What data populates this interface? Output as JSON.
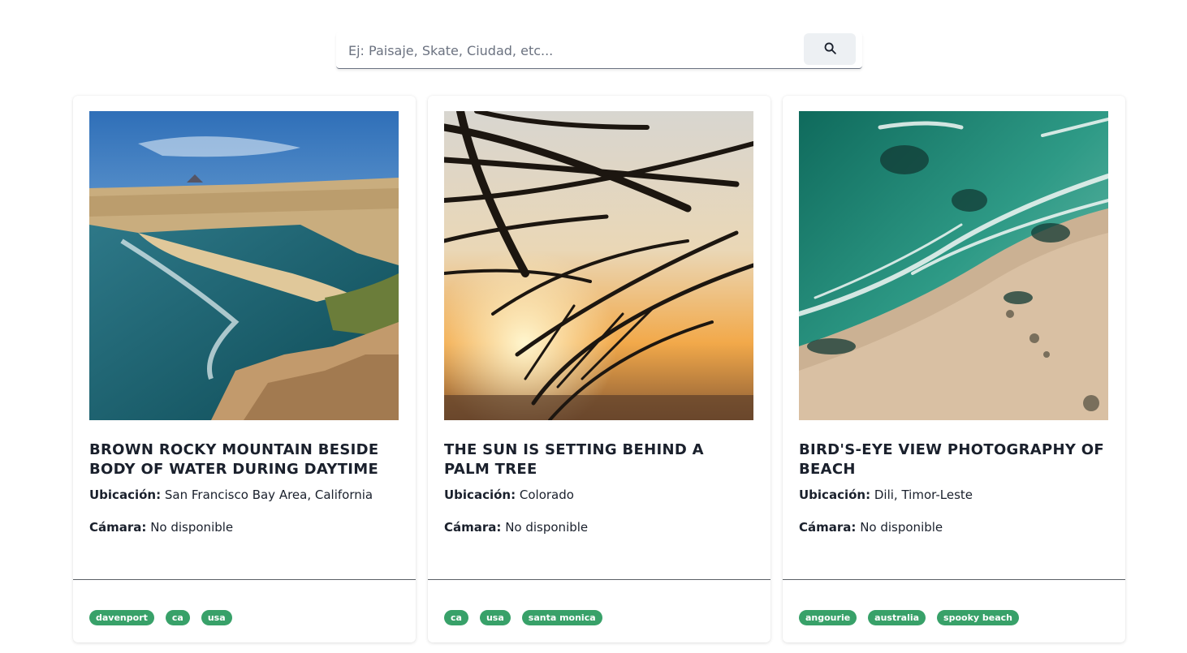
{
  "search": {
    "placeholder": "Ej: Paisaje, Skate, Ciudad, etc...",
    "value": "",
    "button_icon": "search-icon"
  },
  "labels": {
    "location": "Ubicación:",
    "camera": "Cámara:"
  },
  "colors": {
    "tag_bg": "#38a169",
    "search_button_bg": "#edf0f3",
    "text": "#1a202c"
  },
  "cards": [
    {
      "title": "BROWN ROCKY MOUNTAIN BESIDE BODY OF WATER DURING DAYTIME",
      "location": "San Francisco Bay Area, California",
      "camera": "No disponible",
      "tags": [
        "davenport",
        "ca",
        "usa"
      ]
    },
    {
      "title": "THE SUN IS SETTING BEHIND A PALM TREE",
      "location": "Colorado",
      "camera": "No disponible",
      "tags": [
        "ca",
        "usa",
        "santa monica"
      ]
    },
    {
      "title": "BIRD'S-EYE VIEW PHOTOGRAPHY OF BEACH",
      "location": "Dili, Timor-Leste",
      "camera": "No disponible",
      "tags": [
        "angourie",
        "australia",
        "spooky beach"
      ]
    }
  ]
}
